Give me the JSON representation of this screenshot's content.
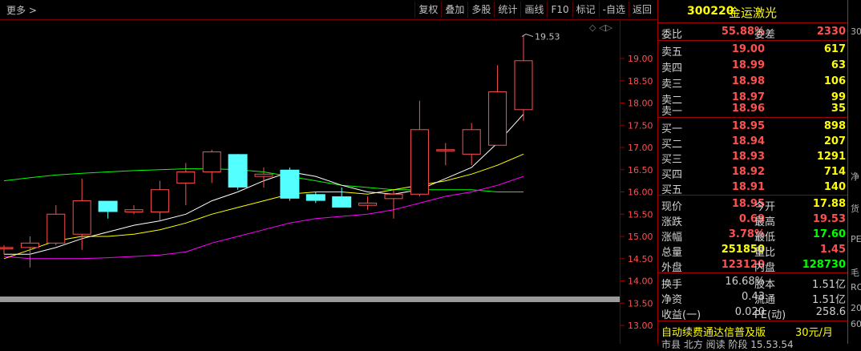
{
  "toolbar": {
    "more": "更多 >",
    "buttons": [
      "复权",
      "叠加",
      "多股",
      "统计",
      "画线",
      "F10",
      "标记",
      "-自选",
      "返回"
    ]
  },
  "chart": {
    "price_ticks": [
      "19.00",
      "18.50",
      "18.00",
      "17.50",
      "17.00",
      "16.50",
      "16.00",
      "15.50",
      "15.00",
      "14.50",
      "14.00",
      "13.50",
      "13.00"
    ],
    "high_marker": "19.53",
    "ctrl_icons": "◇ ◁▷",
    "colors": {
      "up": "#ff5050",
      "down": "#54ffff",
      "ma1": "#ffffff",
      "ma2": "#ffff00",
      "ma3": "#ff00ff",
      "ma4": "#00ff00"
    }
  },
  "chart_data": {
    "type": "candlestick",
    "ylim": [
      12.9,
      19.9
    ],
    "candles": [
      {
        "o": 14.75,
        "c": 14.75,
        "h": 14.8,
        "l": 14.6
      },
      {
        "o": 14.75,
        "c": 14.85,
        "h": 15.0,
        "l": 14.3
      },
      {
        "o": 14.85,
        "c": 15.5,
        "h": 15.7,
        "l": 14.8
      },
      {
        "o": 15.05,
        "c": 15.8,
        "h": 16.3,
        "l": 14.7
      },
      {
        "o": 15.8,
        "c": 15.55,
        "h": 15.8,
        "l": 15.4
      },
      {
        "o": 15.55,
        "c": 15.6,
        "h": 15.7,
        "l": 15.5
      },
      {
        "o": 15.55,
        "c": 16.05,
        "h": 16.25,
        "l": 15.35
      },
      {
        "o": 16.2,
        "c": 16.45,
        "h": 16.65,
        "l": 15.7
      },
      {
        "o": 16.45,
        "c": 16.9,
        "h": 16.95,
        "l": 16.2
      },
      {
        "o": 16.85,
        "c": 16.1,
        "h": 16.85,
        "l": 16.05
      },
      {
        "o": 16.35,
        "c": 16.4,
        "h": 16.55,
        "l": 16.1
      },
      {
        "o": 16.5,
        "c": 15.85,
        "h": 16.55,
        "l": 15.8
      },
      {
        "o": 15.95,
        "c": 15.8,
        "h": 16.0,
        "l": 15.75
      },
      {
        "o": 15.9,
        "c": 15.65,
        "h": 16.1,
        "l": 15.65
      },
      {
        "o": 15.7,
        "c": 15.75,
        "h": 15.9,
        "l": 15.6
      },
      {
        "o": 15.85,
        "c": 15.95,
        "h": 16.05,
        "l": 15.4
      },
      {
        "o": 15.95,
        "c": 17.4,
        "h": 18.05,
        "l": 15.9
      },
      {
        "o": 16.95,
        "c": 16.95,
        "h": 17.1,
        "l": 16.6
      },
      {
        "o": 16.85,
        "c": 17.4,
        "h": 17.55,
        "l": 16.6
      },
      {
        "o": 17.05,
        "c": 18.25,
        "h": 18.85,
        "l": 17.05
      },
      {
        "o": 17.85,
        "c": 18.95,
        "h": 19.53,
        "l": 17.6
      }
    ],
    "ma_white": [
      14.6,
      14.6,
      14.75,
      14.95,
      15.1,
      15.25,
      15.35,
      15.5,
      15.8,
      16.0,
      16.25,
      16.45,
      16.35,
      16.15,
      16.0,
      15.95,
      16.05,
      16.3,
      16.55,
      17.1,
      17.75
    ],
    "ma_yellow": [
      14.5,
      14.7,
      14.9,
      15.0,
      15.0,
      15.05,
      15.15,
      15.3,
      15.5,
      15.65,
      15.8,
      15.95,
      16.0,
      16.0,
      15.95,
      16.05,
      16.15,
      16.25,
      16.4,
      16.6,
      16.85
    ],
    "ma_magenta": [
      14.55,
      14.5,
      14.5,
      14.5,
      14.52,
      14.55,
      14.58,
      14.65,
      14.85,
      15.0,
      15.15,
      15.3,
      15.4,
      15.45,
      15.5,
      15.6,
      15.75,
      15.9,
      16.0,
      16.15,
      16.35
    ],
    "ma_green": [
      16.25,
      16.32,
      16.38,
      16.42,
      16.45,
      16.48,
      16.5,
      16.52,
      16.52,
      16.5,
      16.45,
      16.35,
      16.25,
      16.15,
      16.1,
      16.05,
      16.05,
      16.05,
      16.05,
      16.0,
      16.0
    ]
  },
  "quote": {
    "code": "300220",
    "name": "金运激光",
    "weibi": {
      "label": "委比",
      "value": "55.88%",
      "label2": "委差",
      "value2": "2330"
    },
    "asks": [
      {
        "label": "卖五",
        "price": "19.00",
        "vol": "617"
      },
      {
        "label": "卖四",
        "price": "18.99",
        "vol": "63"
      },
      {
        "label": "卖三",
        "price": "18.98",
        "vol": "106"
      },
      {
        "label": "卖二",
        "price": "18.97",
        "vol": "99"
      },
      {
        "label": "卖一",
        "price": "18.96",
        "vol": "35"
      }
    ],
    "bids": [
      {
        "label": "买一",
        "price": "18.95",
        "vol": "898"
      },
      {
        "label": "买二",
        "price": "18.94",
        "vol": "207"
      },
      {
        "label": "买三",
        "price": "18.93",
        "vol": "1291"
      },
      {
        "label": "买四",
        "price": "18.92",
        "vol": "714"
      },
      {
        "label": "买五",
        "price": "18.91",
        "vol": "140"
      }
    ],
    "stats": [
      {
        "l1": "现价",
        "v1": "18.95",
        "c1": "#ff5050",
        "l2": "今开",
        "v2": "17.88",
        "c2": "#ffff00"
      },
      {
        "l1": "涨跌",
        "v1": "0.69",
        "c1": "#ff5050",
        "l2": "最高",
        "v2": "19.53",
        "c2": "#ff5050"
      },
      {
        "l1": "涨幅",
        "v1": "3.78%",
        "c1": "#ff5050",
        "l2": "最低",
        "v2": "17.60",
        "c2": "#00ff00"
      },
      {
        "l1": "总量",
        "v1": "251850",
        "c1": "#ffff00",
        "l2": "量比",
        "v2": "1.45",
        "c2": "#ff5050"
      },
      {
        "l1": "外盘",
        "v1": "123120",
        "c1": "#ff5050",
        "l2": "内盘",
        "v2": "128730",
        "c2": "#00ff00"
      }
    ],
    "fin": [
      {
        "l1": "换手",
        "v1": "16.68%",
        "l2": "股本",
        "v2": "1.51亿"
      },
      {
        "l1": "净资",
        "v1": "0.43",
        "l2": "流通",
        "v2": "1.51亿"
      },
      {
        "l1": "收益(一)",
        "v1": "0.020",
        "l2": "PE(动)",
        "v2": "258.6"
      }
    ],
    "promo": {
      "text": "自动续费通达信普及版",
      "price": "30元/月"
    },
    "bottom_peek": "市县 北方 阅读 阶段 15.53.54"
  },
  "edge": [
    "30",
    "净",
    "货",
    "PE",
    "毛",
    "RO",
    "20",
    "60"
  ]
}
